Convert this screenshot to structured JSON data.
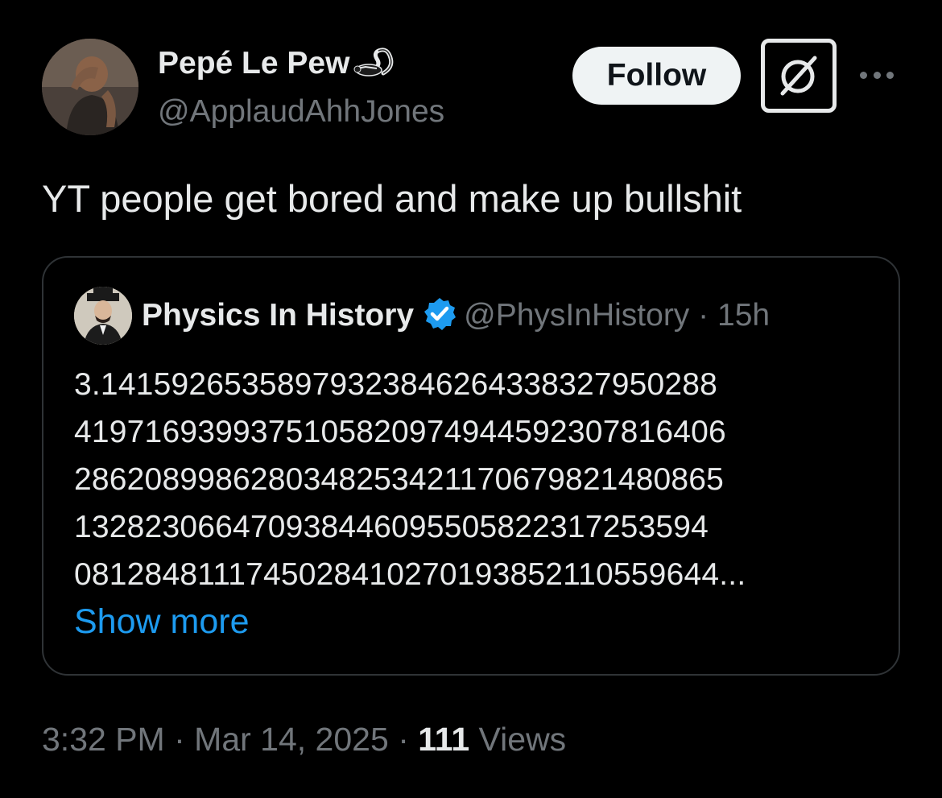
{
  "author": {
    "display_name": "Pepé Le Pew",
    "name_emoji": "skunk-icon",
    "handle": "@ApplaudAhhJones"
  },
  "actions": {
    "follow_label": "Follow",
    "grok_icon": "grok-icon",
    "more_icon": "more-icon"
  },
  "tweet": {
    "text": "YT people get bored and make up bullshit"
  },
  "quote": {
    "name": "Physics In History",
    "verified": true,
    "handle": "@PhysInHistory",
    "separator": "·",
    "time": "15h",
    "lines": [
      "3.1415926535897932384626433832795028​8",
      "419716939937510582097494459230781640​6",
      "286208998628034825342117067982148086​5",
      "132823066470938446095505822317253594",
      "0812848111745028410270193852110559644..."
    ],
    "show_more": "Show more"
  },
  "meta": {
    "time": "3:32 PM",
    "sep1": "·",
    "date": "Mar 14, 2025",
    "sep2": "·",
    "views_count": "111",
    "views_label": "Views"
  },
  "colors": {
    "background": "#000000",
    "text": "#e7e9ea",
    "muted": "#71767b",
    "link": "#1d9bf0",
    "border": "#2f3336",
    "verified": "#1d9bf0"
  }
}
